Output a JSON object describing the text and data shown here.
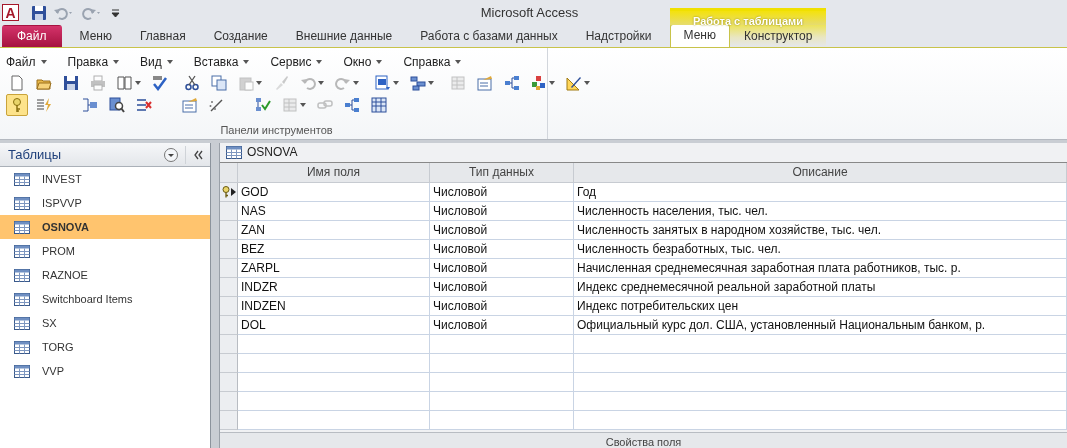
{
  "window": {
    "title": "Microsoft Access",
    "logo": "A"
  },
  "ribbon_tabs": [
    {
      "label": "Файл",
      "kind": "file",
      "selected": false
    },
    {
      "label": "Меню",
      "kind": "normal",
      "selected": false
    },
    {
      "label": "Главная",
      "kind": "normal",
      "selected": false
    },
    {
      "label": "Создание",
      "kind": "normal",
      "selected": false
    },
    {
      "label": "Внешние данные",
      "kind": "normal",
      "selected": false
    },
    {
      "label": "Работа с базами данных",
      "kind": "normal",
      "selected": false
    },
    {
      "label": "Надстройки",
      "kind": "normal",
      "selected": false
    },
    {
      "label": "Меню",
      "kind": "contextual",
      "selected": true
    },
    {
      "label": "Конструктор",
      "kind": "contextual",
      "selected": false
    }
  ],
  "contextual_group": {
    "title": "Работа с таблицами"
  },
  "menu_bar": [
    "Файл",
    "Правка",
    "Вид",
    "Вставка",
    "Сервис",
    "Окно",
    "Справка"
  ],
  "toolbar": {
    "group_label": "Панели инструментов",
    "rows": [
      [
        {
          "kind": "new",
          "disabled": false,
          "selected": false
        },
        {
          "kind": "open",
          "disabled": false,
          "selected": false
        },
        {
          "kind": "save",
          "disabled": false,
          "selected": false
        },
        {
          "kind": "print",
          "disabled": true,
          "selected": false
        },
        {
          "kind": "preview",
          "disabled": false,
          "selected": false,
          "dropdown": true
        },
        {
          "kind": "spell",
          "disabled": false,
          "selected": false
        },
        {
          "kind": "gap"
        },
        {
          "kind": "cut",
          "disabled": false,
          "selected": false
        },
        {
          "kind": "copy",
          "disabled": false,
          "selected": false
        },
        {
          "kind": "paste",
          "disabled": true,
          "selected": false,
          "dropdown": true
        },
        {
          "kind": "brush",
          "disabled": true,
          "selected": false
        },
        {
          "kind": "undo",
          "disabled": true,
          "selected": false,
          "dropdown": true
        },
        {
          "kind": "redo",
          "disabled": true,
          "selected": false,
          "dropdown": true
        },
        {
          "kind": "gap"
        },
        {
          "kind": "word",
          "disabled": false,
          "selected": false,
          "dropdown": true
        },
        {
          "kind": "analyze",
          "disabled": false,
          "selected": false,
          "dropdown": true
        },
        {
          "kind": "gap"
        },
        {
          "kind": "sheet",
          "disabled": true,
          "selected": false
        },
        {
          "kind": "properties",
          "disabled": false,
          "selected": false
        },
        {
          "kind": "relations",
          "disabled": false,
          "selected": false
        },
        {
          "kind": "objects",
          "disabled": false,
          "selected": false,
          "dropdown": true
        },
        {
          "kind": "ruler",
          "disabled": false,
          "selected": false,
          "dropdown": true
        }
      ],
      [
        {
          "kind": "key",
          "disabled": false,
          "selected": true
        },
        {
          "kind": "indexes",
          "disabled": false,
          "selected": false
        },
        {
          "kind": "gap"
        },
        {
          "kind": "insert-rows",
          "disabled": false,
          "selected": false
        },
        {
          "kind": "test",
          "disabled": false,
          "selected": false
        },
        {
          "kind": "delete-rows",
          "disabled": false,
          "selected": false
        },
        {
          "kind": "gap"
        },
        {
          "kind": "properties",
          "disabled": false,
          "selected": false
        },
        {
          "kind": "build",
          "disabled": false,
          "selected": false
        },
        {
          "kind": "gap"
        },
        {
          "kind": "check",
          "disabled": false,
          "selected": false
        },
        {
          "kind": "sheet",
          "disabled": true,
          "selected": false,
          "dropdown": true
        },
        {
          "kind": "link",
          "disabled": true,
          "selected": false
        },
        {
          "kind": "relations",
          "disabled": false,
          "selected": false
        },
        {
          "kind": "grid",
          "disabled": false,
          "selected": false
        }
      ]
    ]
  },
  "navigation": {
    "title": "Таблицы",
    "items": [
      {
        "label": "INVEST",
        "selected": false
      },
      {
        "label": "ISPVVP",
        "selected": false
      },
      {
        "label": "OSNOVA",
        "selected": true
      },
      {
        "label": "PROM",
        "selected": false
      },
      {
        "label": "RAZNOE",
        "selected": false
      },
      {
        "label": "Switchboard Items",
        "selected": false
      },
      {
        "label": "SX",
        "selected": false
      },
      {
        "label": "TORG",
        "selected": false
      },
      {
        "label": "VVP",
        "selected": false
      }
    ]
  },
  "document": {
    "title": "OSNOVA",
    "columns": [
      "Имя поля",
      "Тип данных",
      "Описание"
    ],
    "rows": [
      {
        "name": "GOD",
        "type": "Числовой",
        "description": "Год",
        "primary_key": true,
        "current": true
      },
      {
        "name": "NAS",
        "type": "Числовой",
        "description": "Численность населения, тыс. чел.",
        "primary_key": false,
        "current": false
      },
      {
        "name": "ZAN",
        "type": "Числовой",
        "description": "Численность занятых в народном хозяйстве, тыс. чел.",
        "primary_key": false,
        "current": false
      },
      {
        "name": "BEZ",
        "type": "Числовой",
        "description": "Численность безработных, тыс. чел.",
        "primary_key": false,
        "current": false
      },
      {
        "name": "ZARPL",
        "type": "Числовой",
        "description": "Начисленная среднемесячная заработная плата работников, тыс. р.",
        "primary_key": false,
        "current": false
      },
      {
        "name": "INDZR",
        "type": "Числовой",
        "description": "Индекс среднемесячной реальной заработной платы",
        "primary_key": false,
        "current": false
      },
      {
        "name": "INDZEN",
        "type": "Числовой",
        "description": "Индекс потребительских цен",
        "primary_key": false,
        "current": false
      },
      {
        "name": "DOL",
        "type": "Числовой",
        "description": "Официальный курс дол. США, установленный Национальным банком, р.",
        "primary_key": false,
        "current": false
      }
    ],
    "properties_label": "Свойства поля"
  }
}
